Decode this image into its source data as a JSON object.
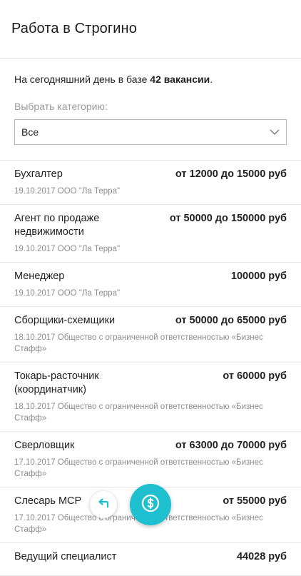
{
  "header": {
    "title": "Работа в Строгино"
  },
  "summary": {
    "prefix": "На сегодняшний день в базе ",
    "count": "42 вакансии",
    "suffix": "."
  },
  "category": {
    "label": "Выбрать категорию:",
    "selected": "Все"
  },
  "jobs": [
    {
      "title": "Бухгалтер",
      "salary": "от 12000 до 15000 руб",
      "meta": "19.10.2017 ООО \"Ла Терра\""
    },
    {
      "title": "Агент по продаже недвижимости",
      "salary": "от 50000 до 150000 руб",
      "meta": "19.10.2017 ООО \"Ла Терра\""
    },
    {
      "title": "Менеджер",
      "salary": "100000 руб",
      "meta": "19.10.2017 ООО \"Ла Терра\""
    },
    {
      "title": "Сборщики-схемщики",
      "salary": "от 50000 до 65000 руб",
      "meta": "18.10.2017 Общество с ограниченной ответственностью «Бизнес Стафф»"
    },
    {
      "title": "Токарь-расточник (координатчик)",
      "salary": "от 60000 руб",
      "meta": "18.10.2017 Общество с ограниченной ответственностью «Бизнес Стафф»"
    },
    {
      "title": "Сверловщик",
      "salary": "от 63000 до 70000 руб",
      "meta": "17.10.2017 Общество с ограниченной ответственностью «Бизнес Стафф»"
    },
    {
      "title": "Слесарь МСР",
      "salary": "от 55000 руб",
      "meta": "17.10.2017 Общество с ограниченной ответственностью «Бизнес Стафф»"
    },
    {
      "title": "Ведущий специалист",
      "salary": "44028 руб",
      "meta": ""
    }
  ],
  "icons": {
    "back": "reply-arrow-icon",
    "money": "dollar-icon",
    "chevron": "chevron-down-icon"
  },
  "colors": {
    "accent": "#1ec0cf"
  }
}
